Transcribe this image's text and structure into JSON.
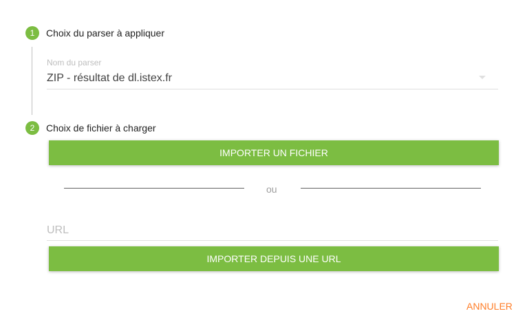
{
  "steps": [
    {
      "number": "1",
      "title": "Choix du parser à appliquer"
    },
    {
      "number": "2",
      "title": "Choix de fichier à charger"
    }
  ],
  "parser_select": {
    "label": "Nom du parser",
    "value": "ZIP - résultat de dl.istex.fr"
  },
  "upload": {
    "file_button": "IMPORTER UN FICHIER",
    "separator": "ou",
    "url_placeholder": "URL",
    "url_value": "",
    "url_button": "IMPORTER DEPUIS UNE URL"
  },
  "actions": {
    "cancel": "ANNULER"
  },
  "colors": {
    "accent_green": "#7cbd42",
    "cancel_orange": "#ff7d27"
  }
}
